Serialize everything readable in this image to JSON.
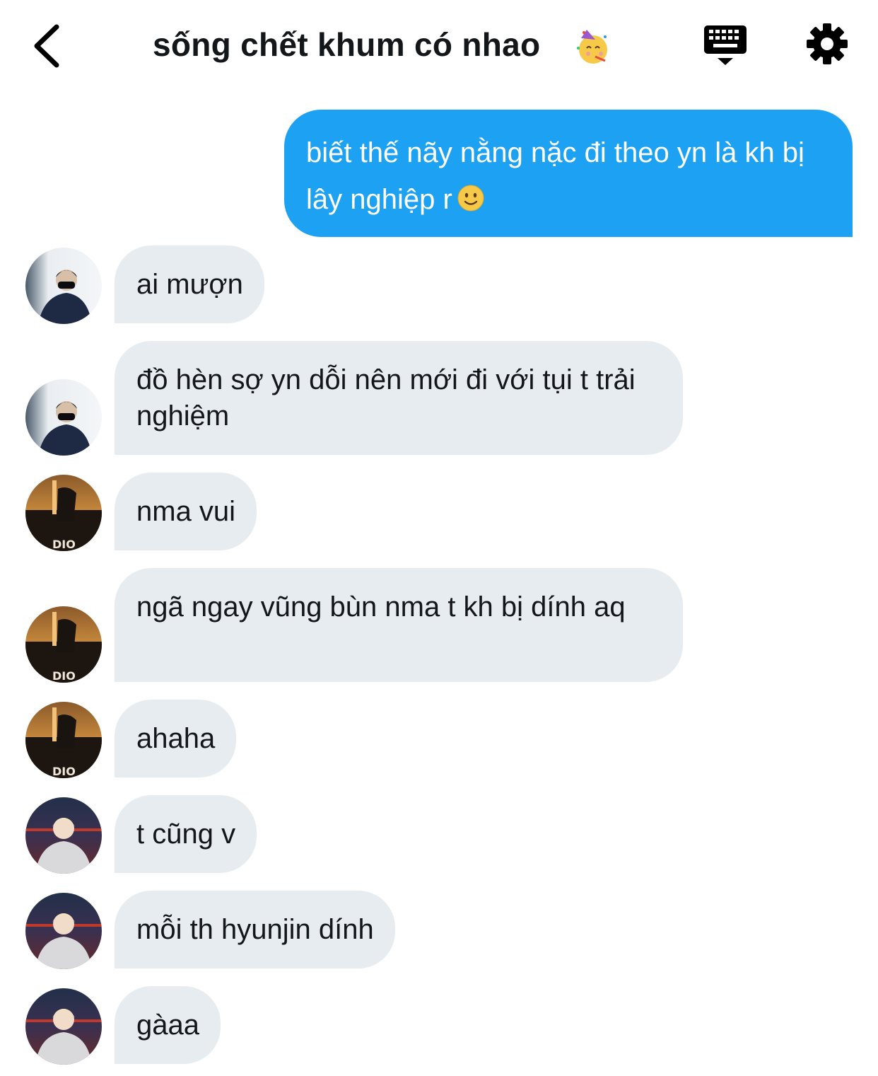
{
  "header": {
    "title": "sống chết khum có nhao",
    "title_emoji_icon": "partying-face-icon",
    "back_icon": "chevron-left-icon",
    "keyboard_icon": "keyboard-icon",
    "settings_icon": "gear-icon"
  },
  "colors": {
    "outgoing_bubble": "#1da1f2",
    "incoming_bubble": "#e6ecf0",
    "text": "#14171a"
  },
  "messages": [
    {
      "direction": "outgoing",
      "text": "biết thế nãy nằng nặc đi theo yn là kh bị lây nghiệp r",
      "emoji_icon": "slightly-smiling-face-icon"
    },
    {
      "direction": "incoming",
      "text": "ai mượn",
      "avatar": "user-a"
    },
    {
      "direction": "incoming",
      "text": "đồ hèn sợ yn dỗi nên mới đi với tụi t trải nghiệm",
      "avatar": "user-a"
    },
    {
      "direction": "incoming",
      "text": "nma vui",
      "avatar": "user-b"
    },
    {
      "direction": "incoming",
      "text": "ngã ngay vũng bùn nma t kh bị dính aq",
      "avatar": "user-b"
    },
    {
      "direction": "incoming",
      "text": "ahaha",
      "avatar": "user-b"
    },
    {
      "direction": "incoming",
      "text": "t cũng v",
      "avatar": "user-c"
    },
    {
      "direction": "incoming",
      "text": "mỗi th hyunjin dính",
      "avatar": "user-c"
    },
    {
      "direction": "incoming",
      "text": "gàaa",
      "avatar": "user-c"
    }
  ]
}
